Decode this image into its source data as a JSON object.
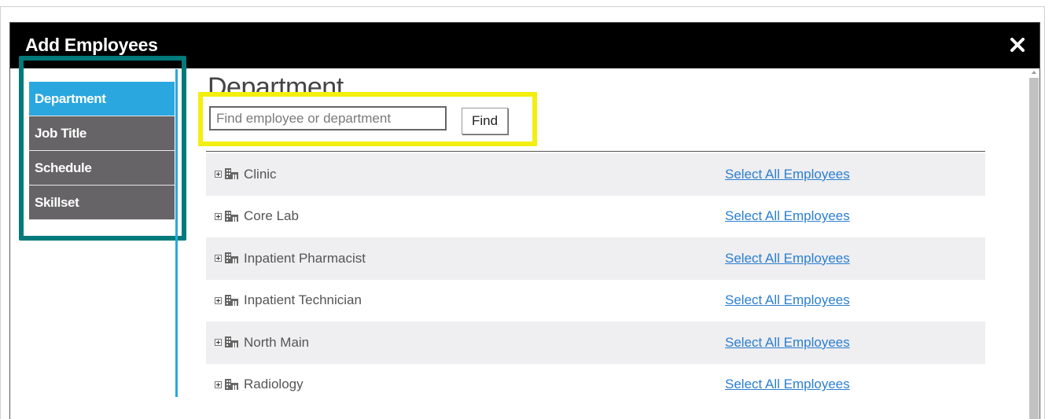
{
  "modal": {
    "title": "Add Employees",
    "close_icon": "close-x-icon"
  },
  "sidebar": {
    "items": [
      {
        "label": "Department",
        "active": true
      },
      {
        "label": "Job Title",
        "active": false
      },
      {
        "label": "Schedule",
        "active": false
      },
      {
        "label": "Skillset",
        "active": false
      }
    ]
  },
  "main": {
    "heading": "Department",
    "search": {
      "placeholder": "Find employee or department",
      "value": ""
    },
    "find_label": "Find",
    "departments": [
      {
        "name": "Clinic",
        "link": "Select All Employees"
      },
      {
        "name": "Core Lab",
        "link": "Select All Employees"
      },
      {
        "name": "Inpatient Pharmacist",
        "link": "Select All Employees"
      },
      {
        "name": "Inpatient Technician",
        "link": "Select All Employees"
      },
      {
        "name": "North Main",
        "link": "Select All Employees"
      },
      {
        "name": "Radiology",
        "link": "Select All Employees"
      }
    ]
  },
  "colors": {
    "active_nav": "#2aa7df",
    "nav_bg": "#666466",
    "highlight_sidebar": "#007a7a",
    "highlight_search": "#f3ef10",
    "link": "#2a7fd0"
  }
}
